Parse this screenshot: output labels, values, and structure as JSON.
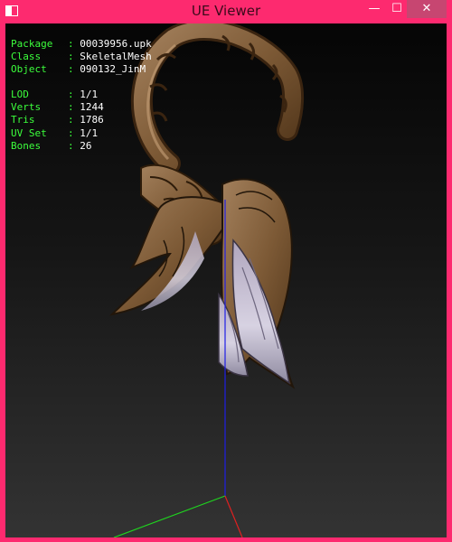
{
  "window": {
    "title": "UE Viewer",
    "minimize_glyph": "—",
    "maximize_glyph": "☐",
    "close_glyph": "✕"
  },
  "colors": {
    "frame": "#fd2a6f",
    "info_label": "#3cff3c",
    "info_value": "#ffffff",
    "axis_x": "#e02020",
    "axis_y": "#20d020",
    "axis_z": "#2020e0"
  },
  "info": {
    "object_rows": [
      {
        "label": "Package",
        "value": "00039956.upk"
      },
      {
        "label": "Class",
        "value": "SkeletalMesh"
      },
      {
        "label": "Object",
        "value": "090132_JinM"
      }
    ],
    "stats_rows": [
      {
        "label": "LOD",
        "value": "1/1"
      },
      {
        "label": "Verts",
        "value": "1244"
      },
      {
        "label": "Tris",
        "value": "1786"
      },
      {
        "label": "UV Set",
        "value": "1/1"
      },
      {
        "label": "Bones",
        "value": "26"
      }
    ]
  },
  "icons": {
    "app": "app-window-icon",
    "model": "winged-ornament-mesh"
  }
}
